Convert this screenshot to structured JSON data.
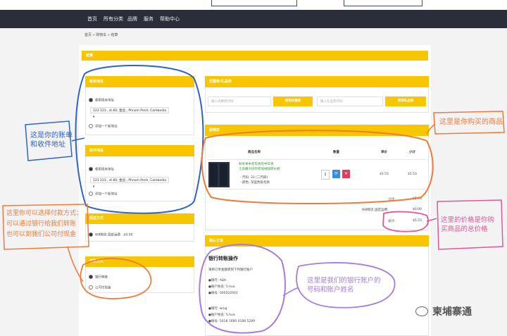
{
  "nav": {
    "items": [
      "首页",
      "所有分类",
      "品牌",
      "服务",
      "帮助中心"
    ]
  },
  "breadcrumb": "首页 » 购物车 » 结算",
  "checkout_title": "结算",
  "billing": {
    "title": "帐单地址",
    "use_existing": "使用现有地址",
    "address": "123 123 , st.60, 金边 , Phnom Penh, Cambodia",
    "add_new": "添加一个新地址"
  },
  "shipping": {
    "title": "收件地址",
    "use_existing": "使用现有地址",
    "address": "123 123 , st.60, 金边 , Phnom Penh, Cambodia",
    "add_new": "添加一个新地址"
  },
  "delivery": {
    "title": "配送方式",
    "option": "WB物流 固定运费 - $0.00"
  },
  "payment": {
    "title": "付款方式",
    "options": [
      "银行转账",
      "公司付现金"
    ]
  },
  "coupon": {
    "title": "优惠券/礼品券",
    "coupon_placeholder": "输入优惠券代码",
    "coupon_button": "使用优惠券",
    "voucher_placeholder": "输入礼品券代码",
    "voucher_button": "使用礼品券"
  },
  "cart": {
    "title": "购物车",
    "headers": [
      "商品名称",
      "数量",
      "单价",
      "小计"
    ],
    "product_name_1": "秋冬季中老年男装中年男",
    "product_name_2": "士高腰大码针织加绒加厚长裤",
    "option_size": "- 尺码: 31 (二尺四)",
    "option_color": "- 颜色: 深蓝色吸毛款",
    "qty": "1",
    "price": "$5.53",
    "subtotal": "$5.53",
    "totals": [
      {
        "label": "小计:",
        "value": "$5.53"
      },
      {
        "label": "WB物流 固定运费:",
        "value": "$0.00"
      },
      {
        "label": "总计:",
        "value": "$5.53"
      }
    ]
  },
  "confirm": {
    "title": "确认订单",
    "bank_title": "银行转账操作",
    "instruction": "请将订单金额转到下列银行账户",
    "bank1": [
      "●银行: ABA",
      "●账户姓名: S hua",
      "●账号: 000322003"
    ],
    "bank2": [
      "●银行: wing",
      "●账户姓名: S hua",
      "●账号: 5018 1680 0188 5289"
    ]
  },
  "annotations": {
    "billing": [
      "这是你的账单",
      "和收件地址"
    ],
    "payment": [
      "这里你可以选择付款方式：",
      "可以通过银行给我们转账",
      "也可以到我们公司付现金"
    ],
    "product": [
      "这里是你购买的商品"
    ],
    "total": [
      "这里的价格是你购",
      "买商品的总价格"
    ],
    "bank": [
      "这里是我们的银行账户的",
      "号码和账户姓名"
    ]
  },
  "watermark": "柬埔寨通",
  "colors": {
    "accent": "#f7c600",
    "navbar": "#2b2e3a",
    "blue_ring": "#2f63c8",
    "orange_ring": "#f07a3a",
    "purple_ring": "#a77be0",
    "pink_ring": "#e0579a"
  }
}
